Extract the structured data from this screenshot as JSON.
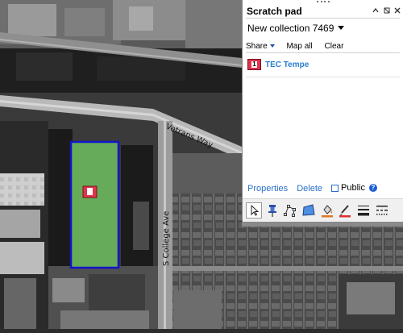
{
  "panel": {
    "title": "Scratch pad",
    "collection_name": "New collection 7469",
    "toolbar": {
      "share_label": "Share",
      "map_all_label": "Map all",
      "clear_label": "Clear"
    },
    "items": [
      {
        "number": "1",
        "label": "TEC Tempe"
      }
    ],
    "footer": {
      "properties_label": "Properties",
      "delete_label": "Delete",
      "public_label": "Public",
      "public_checked": false
    },
    "drawing_tools": [
      "pointer-icon",
      "pushpin-icon",
      "polyline-icon",
      "polygon-icon",
      "fill-color-icon",
      "line-color-icon",
      "line-width-icon",
      "line-style-icon"
    ],
    "accent_color": "#2a7fd0",
    "marker_color": "#e0334c"
  },
  "map": {
    "streets": [
      "Vetrans Way",
      "S College Ave"
    ],
    "marker_number": "1",
    "polygon_fill": "#6fbf5f",
    "polygon_stroke": "#1414c8"
  }
}
